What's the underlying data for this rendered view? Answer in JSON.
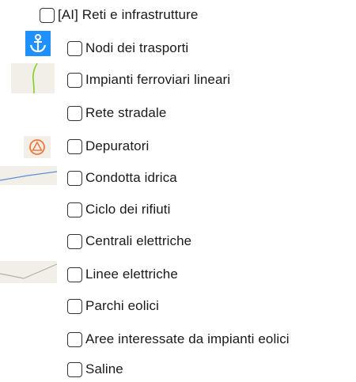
{
  "group": {
    "label": "[AI] Reti e infrastrutture",
    "checked": false
  },
  "layers": [
    {
      "label": "Nodi dei trasporti",
      "checked": false,
      "icon": "anchor-icon",
      "color": "#1e90ff"
    },
    {
      "label": "Impianti ferroviari lineari",
      "checked": false,
      "icon": "rail-line-icon",
      "color": "#7ed321"
    },
    {
      "label": "Rete stradale",
      "checked": false,
      "icon": ""
    },
    {
      "label": "Depuratori",
      "checked": false,
      "icon": "triangle-in-circle-icon",
      "color": "#f07a3a"
    },
    {
      "label": "Condotta idrica",
      "checked": false,
      "icon": "water-line-icon",
      "color": "#5b8fd8"
    },
    {
      "label": "Ciclo dei rifiuti",
      "checked": false,
      "icon": ""
    },
    {
      "label": "Centrali elettriche",
      "checked": false,
      "icon": ""
    },
    {
      "label": "Linee elettriche",
      "checked": false,
      "icon": "power-line-icon",
      "color": "#b0b0b0"
    },
    {
      "label": "Parchi eolici",
      "checked": false,
      "icon": ""
    },
    {
      "label": "Aree interessate da impianti eolici",
      "checked": false,
      "icon": ""
    },
    {
      "label": "Saline",
      "checked": false,
      "icon": ""
    }
  ]
}
